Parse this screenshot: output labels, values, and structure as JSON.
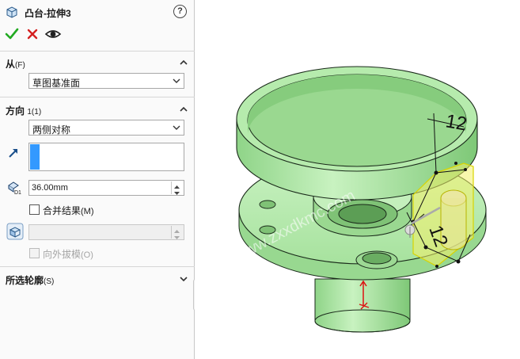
{
  "window": {
    "title": "凸台-拉伸3"
  },
  "help": {
    "label": "?"
  },
  "from_group": {
    "title": "从",
    "shortcut": "(F)",
    "selected": "草图基准面"
  },
  "direction_group": {
    "title": "方向",
    "index": "1(1)",
    "end_condition": "两侧对称",
    "depth_value": "36.00mm",
    "merge_label": "合并结果",
    "merge_shortcut": "(M)",
    "merge_checked": false,
    "draft_label": "向外拔模",
    "draft_shortcut": "(O)",
    "draft_checked": false
  },
  "contours_group": {
    "title": "所选轮廓",
    "shortcut": "(S)"
  },
  "viewport": {
    "dimension_top": "12",
    "dimension_right": "12",
    "watermark": "www.zxxdkmc.com"
  },
  "colors": {
    "model_green": "#a8e6a0",
    "model_edge": "#1a2a1a",
    "preview_yellow": "#f4f06a",
    "confirm_green": "#22aa22",
    "cancel_red": "#d42020",
    "selection_blue": "#3399ff"
  }
}
